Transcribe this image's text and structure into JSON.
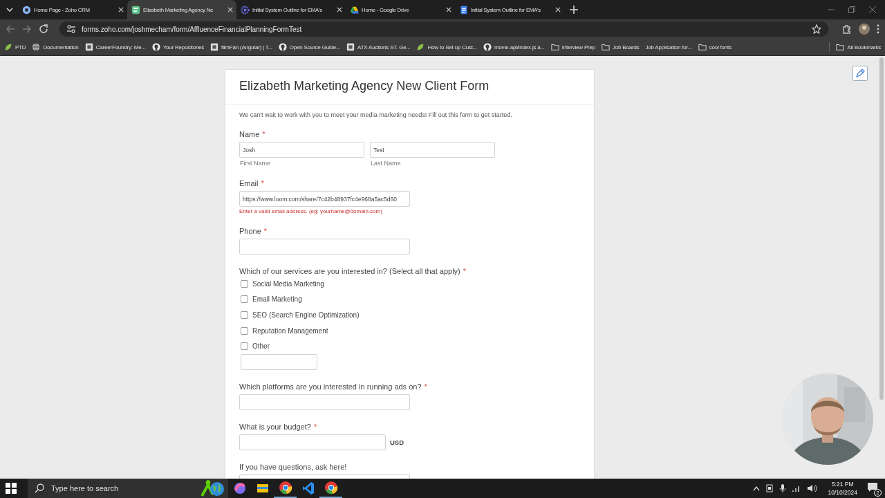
{
  "tabs": [
    {
      "title": "Home Page - Zoho CRM",
      "kind": "crm",
      "selected": false
    },
    {
      "title": "Elizabeth Marketing Agency Ne",
      "kind": "forms",
      "selected": true
    },
    {
      "title": "Initial System Outline for EMA's",
      "kind": "gear",
      "selected": false
    },
    {
      "title": "Home - Google Drive",
      "kind": "drive",
      "selected": false
    },
    {
      "title": "Initial System Outline for EMA's",
      "kind": "doc",
      "selected": false
    }
  ],
  "address_bar": {
    "url": "forms.zoho.com/joshmecham/form/AffluenceFinancialPlanningFormTest"
  },
  "bookmarks": [
    {
      "label": "PTD",
      "kind": "leaf"
    },
    {
      "label": "Documentation",
      "kind": "globe"
    },
    {
      "label": "CareerFoundry: Me...",
      "kind": "square"
    },
    {
      "label": "Your Repositories",
      "kind": "github"
    },
    {
      "label": "filmFan (Angular) | T...",
      "kind": "square"
    },
    {
      "label": "Open Source Guide...",
      "kind": "github"
    },
    {
      "label": "ATX Auctions ST. Ge...",
      "kind": "square"
    },
    {
      "label": "How to Set up Cust...",
      "kind": "leaf"
    },
    {
      "label": "movie-api/index.js a...",
      "kind": "github"
    },
    {
      "label": "Interview Prep",
      "kind": "folder"
    },
    {
      "label": "Job Boards",
      "kind": "folder"
    },
    {
      "label": "Job Application for...",
      "kind": "none"
    },
    {
      "label": "cool fonts",
      "kind": "folder"
    }
  ],
  "all_bookmarks": {
    "label": "All Bookmarks"
  },
  "form": {
    "title": "Elizabeth Marketing Agency New Client Form",
    "description": "We can't wait to work with you to meet your media marketing needs! Fill out this form to get started.",
    "fields": [
      {
        "kind": "name",
        "label": "Name",
        "required_mark": "*",
        "parts": [
          {
            "value": "Josh",
            "sublabel": "First Name"
          },
          {
            "value": "Test",
            "sublabel": "Last Name"
          }
        ]
      },
      {
        "kind": "text",
        "label": "Email",
        "required_mark": "*",
        "value": "https://www.loom.com/share/7c42b48937fc4e968a5ac5d60",
        "error": "Enter a valid email address. (eg: yourname@domain.com)"
      },
      {
        "kind": "text",
        "label": "Phone",
        "required_mark": "*"
      },
      {
        "kind": "checkboxes",
        "label": "Which of our services are you interested in? (Select all that apply)",
        "required_mark": "*",
        "options": [
          {
            "label": "Social Media Marketing",
            "checked": false
          },
          {
            "label": "Email Marketing",
            "checked": false
          },
          {
            "label": "SEO (Search Engine Optimization)",
            "checked": false
          },
          {
            "label": "Reputation Management",
            "checked": false
          },
          {
            "label": "Other",
            "checked": false
          }
        ]
      },
      {
        "kind": "text",
        "label": "Which platforms are you interested in running ads on?",
        "required_mark": "*"
      },
      {
        "kind": "currency",
        "label": "What is your budget?",
        "required_mark": "*",
        "unit": "USD"
      },
      {
        "kind": "text",
        "label": "If you have questions, ask here!"
      }
    ]
  },
  "taskbar": {
    "search_placeholder": "Type here to search",
    "time": "5:21 PM",
    "date": "10/10/2024",
    "notifications": "2"
  }
}
